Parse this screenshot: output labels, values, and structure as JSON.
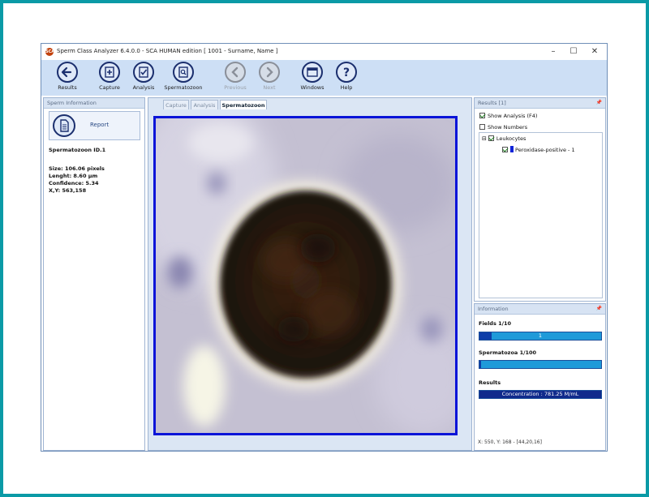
{
  "window": {
    "title": "Sperm Class Analyzer 6.4.0.0 - SCA HUMAN edition [ 1001 - Surname, Name ]",
    "app_icon": "SCA"
  },
  "toolbar": {
    "buttons": [
      {
        "label": "Results",
        "icon": "arrow-left-icon",
        "enabled": true
      },
      {
        "label": "Capture",
        "icon": "capture-add-icon",
        "enabled": true
      },
      {
        "label": "Analysis",
        "icon": "analysis-check-icon",
        "enabled": true
      },
      {
        "label": "Spermatozoon",
        "icon": "magnify-document-icon",
        "enabled": true
      },
      {
        "label": "Previous",
        "icon": "chevron-left-icon",
        "enabled": false
      },
      {
        "label": "Next",
        "icon": "chevron-right-icon",
        "enabled": false
      },
      {
        "label": "Windows",
        "icon": "windows-icon",
        "enabled": true
      },
      {
        "label": "Help",
        "icon": "help-icon",
        "enabled": true
      }
    ]
  },
  "left_panel": {
    "header": "Sperm Information",
    "report_label": "Report",
    "sperm_id": "Spermatozoon ID.1",
    "size": "Size: 106.06 pixels",
    "length": "Lenght: 8.60 µm",
    "confidence": "Confidence: 5.34",
    "xy": "X,Y: 563,158"
  },
  "center": {
    "tabs": [
      {
        "label": "Capture",
        "active": false
      },
      {
        "label": "Analysis",
        "active": false
      },
      {
        "label": "Spermatozoon",
        "active": true
      }
    ]
  },
  "results_panel": {
    "header": "Results [1]",
    "show_analysis": {
      "label": "Show Analysis (F4)",
      "checked": true
    },
    "show_numbers": {
      "label": "Show Numbers",
      "checked": false
    },
    "tree": {
      "group_label": "Leukocytes",
      "group_checked": true,
      "expander": "⊟",
      "item_label": "Peroxidase-positive - 1",
      "item_checked": true,
      "item_color": "#1024d8"
    }
  },
  "info_panel": {
    "header": "Information",
    "fields_label": "Fields 1/10",
    "fields_value": "1",
    "fields_progress": 0.1,
    "spermatozoa_label": "Spermatozoa 1/100",
    "spermatozoa_progress": 0.01,
    "results_label": "Results",
    "concentration": "Concentration : 781.25 M/mL",
    "coords": "X: 550, Y: 168 - [44,20,16]"
  },
  "colors": {
    "accent_border": "#0a14d8",
    "progress_bg": "#1f9ad9",
    "progress_fill": "#0e3ea8",
    "background": "#0a9aa6"
  }
}
